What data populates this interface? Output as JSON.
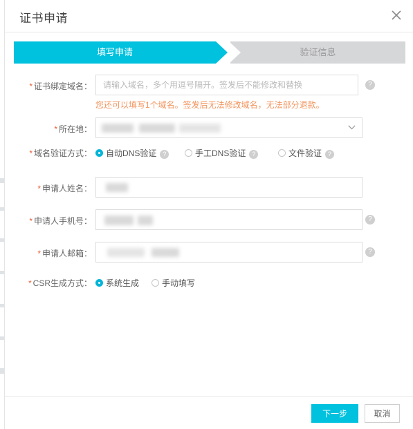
{
  "dialog": {
    "title": "证书申请",
    "close_icon_label": "×"
  },
  "steps": [
    {
      "label": "填写申请",
      "state": "active"
    },
    {
      "label": "验证信息",
      "state": "inactive"
    }
  ],
  "form": {
    "domain": {
      "label": "证书绑定域名：",
      "required": true,
      "value": "",
      "placeholder": "请输入域名，多个用逗号隔开。签发后不能修改和替换",
      "help": "?",
      "hint": "您还可以填写1个域名。签发后无法修改域名，无法部分退款。",
      "hint_color": "#f3945e"
    },
    "location": {
      "label": "所在地：",
      "required": true,
      "value": "",
      "redacted": true,
      "chevron_icon": "chevron-down"
    },
    "verify_method": {
      "label": "域名验证方式：",
      "required": true,
      "options": [
        {
          "label": "自动DNS验证",
          "selected": true,
          "help": "?"
        },
        {
          "label": "手工DNS验证",
          "selected": false,
          "help": "?"
        },
        {
          "label": "文件验证",
          "selected": false,
          "help": "?"
        }
      ]
    },
    "applicant_name": {
      "label": "申请人姓名：",
      "required": true,
      "value": "",
      "redacted": true
    },
    "applicant_phone": {
      "label": "申请人手机号：",
      "required": true,
      "value": "",
      "redacted": true,
      "help": "?"
    },
    "applicant_email": {
      "label": "申请人邮箱：",
      "required": true,
      "value": "",
      "redacted": true,
      "help": "?"
    },
    "csr_method": {
      "label": "CSR生成方式：",
      "required": true,
      "options": [
        {
          "label": "系统生成",
          "selected": true
        },
        {
          "label": "手动填写",
          "selected": false
        }
      ]
    }
  },
  "footer": {
    "primary_label": "下一步",
    "cancel_label": "取消"
  },
  "colors": {
    "accent": "#00c1de",
    "radio_on": "#00b5d8",
    "step_inactive": "#d6d7d9",
    "hint": "#f3945e",
    "required_star": "#e8613c"
  }
}
